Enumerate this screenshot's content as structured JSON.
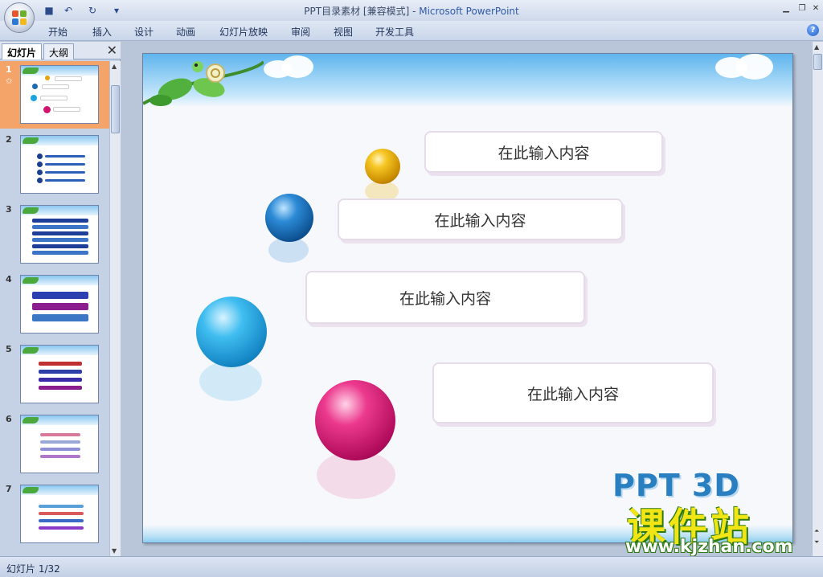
{
  "window": {
    "title_doc": "PPT目录素材 [兼容模式]",
    "title_sep": " - ",
    "title_app": "Microsoft PowerPoint"
  },
  "quick_access": [
    {
      "name": "save-icon",
      "glyph": "💾"
    },
    {
      "name": "undo-icon",
      "glyph": "↶"
    },
    {
      "name": "redo-icon",
      "glyph": "↻"
    },
    {
      "name": "customize-icon",
      "glyph": "▾"
    }
  ],
  "window_controls": [
    {
      "name": "minimize-icon",
      "glyph": "▁"
    },
    {
      "name": "restore-icon",
      "glyph": "❐"
    },
    {
      "name": "close-icon",
      "glyph": "✕"
    }
  ],
  "ribbon_tabs": [
    "开始",
    "插入",
    "设计",
    "动画",
    "幻灯片放映",
    "审阅",
    "视图",
    "开发工具"
  ],
  "help_glyph": "?",
  "left_pane": {
    "tab_slides": "幻灯片",
    "tab_outline": "大纲",
    "close_glyph": "✕",
    "star_glyph": "✩",
    "thumbnails": [
      "1",
      "2",
      "3",
      "4",
      "5",
      "6",
      "7"
    ],
    "selected_index": 0
  },
  "slide": {
    "bubbles": [
      {
        "text": "在此输入内容",
        "sphere_color": "gold"
      },
      {
        "text": "在此输入内容",
        "sphere_color": "dark-blue"
      },
      {
        "text": "在此输入内容",
        "sphere_color": "sky-blue"
      },
      {
        "text": "在此输入内容",
        "sphere_color": "magenta"
      }
    ]
  },
  "watermark": {
    "brand": "PPT 3D",
    "site_cn": "课件站",
    "url": "www.kjzhan.com"
  },
  "status": {
    "slide_counter": "幻灯片 1/32"
  },
  "colors": {
    "gold": "#e2a410",
    "dark_blue": "#1d6bb0",
    "sky_blue": "#1fa3df",
    "magenta": "#d01470",
    "selected_thumb": "#f4a468"
  }
}
